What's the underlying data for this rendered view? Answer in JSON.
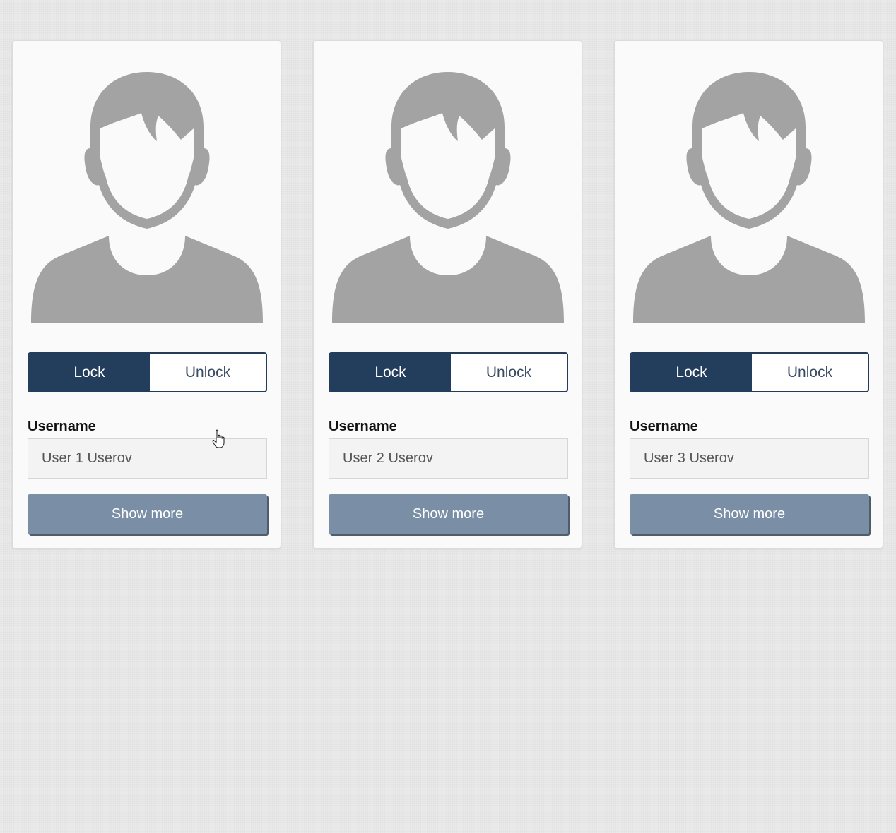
{
  "cards": [
    {
      "toggle": {
        "lock_label": "Lock",
        "unlock_label": "Unlock",
        "selected": "Lock"
      },
      "username_label": "Username",
      "username_value": "User 1 Userov",
      "show_more_label": "Show more",
      "avatar_icon": "user-avatar-icon"
    },
    {
      "toggle": {
        "lock_label": "Lock",
        "unlock_label": "Unlock",
        "selected": "Lock"
      },
      "username_label": "Username",
      "username_value": "User 2 Userov",
      "show_more_label": "Show more",
      "avatar_icon": "user-avatar-icon"
    },
    {
      "toggle": {
        "lock_label": "Lock",
        "unlock_label": "Unlock",
        "selected": "Lock"
      },
      "username_label": "Username",
      "username_value": "User 3 Userov",
      "show_more_label": "Show more",
      "avatar_icon": "user-avatar-icon"
    }
  ],
  "colors": {
    "background": "#e9e9e9",
    "card": "#fafafa",
    "toggle_active": "#233d5c",
    "toggle_border": "#243b5a",
    "button": "#7a8fa6",
    "avatar": "#a3a3a3"
  },
  "cursor_icon": "hand-pointer-icon"
}
